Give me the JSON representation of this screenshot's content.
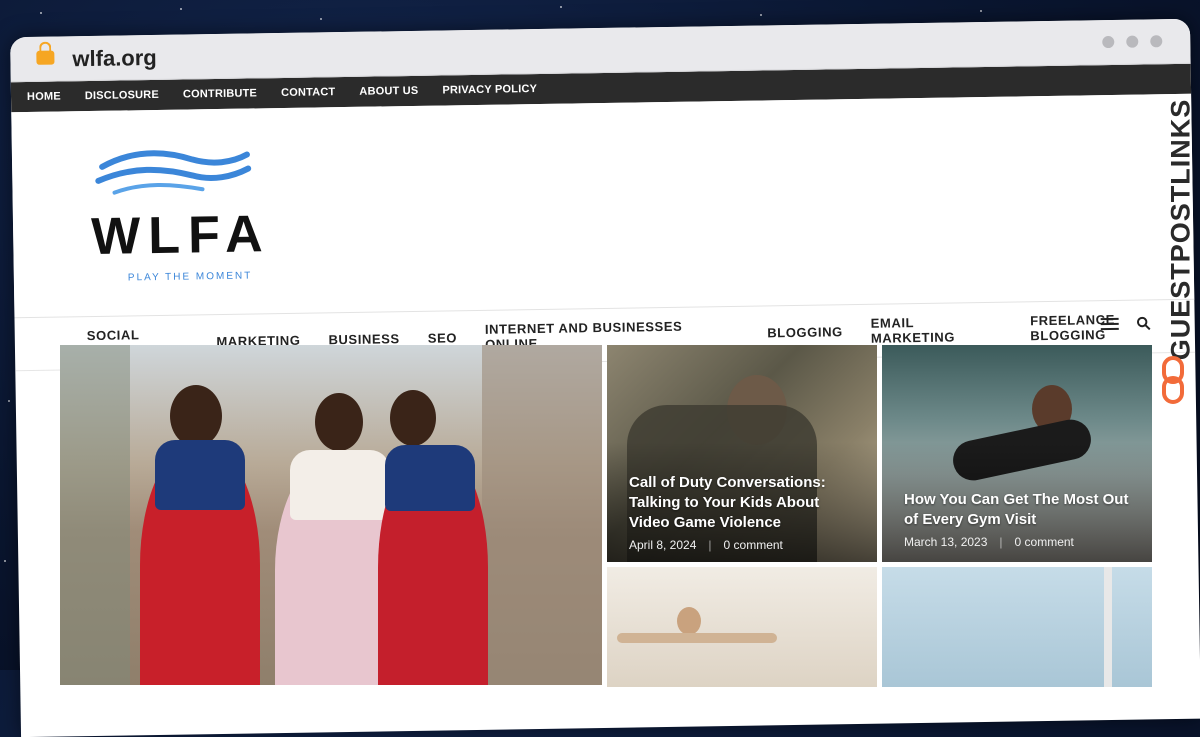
{
  "browser": {
    "url": "wlfa.org"
  },
  "top_menu": [
    "HOME",
    "DISCLOSURE",
    "CONTRIBUTE",
    "CONTACT",
    "ABOUT US",
    "PRIVACY POLICY"
  ],
  "logo": {
    "name": "WLFA",
    "tagline": "PLAY THE MOMENT"
  },
  "main_menu": [
    "SOCIAL MEDIA",
    "MARKETING",
    "BUSINESS",
    "SEO",
    "INTERNET AND BUSINESSES ONLINE",
    "BLOGGING",
    "EMAIL MARKETING",
    "FREELANCE BLOGGING"
  ],
  "posts": [
    {
      "title": "Call of Duty Conversations: Talking to Your Kids About Video Game Violence",
      "date": "April 8, 2024",
      "comments": "0 comment"
    },
    {
      "title": "How You Can Get The Most Out of Every Gym Visit",
      "date": "March 13, 2023",
      "comments": "0 comment"
    }
  ],
  "watermark": "GUESTPOSTLINKS",
  "colors": {
    "accent": "#3b86d9",
    "badge": "#f26b3a",
    "topbar": "#2b2b2b"
  }
}
